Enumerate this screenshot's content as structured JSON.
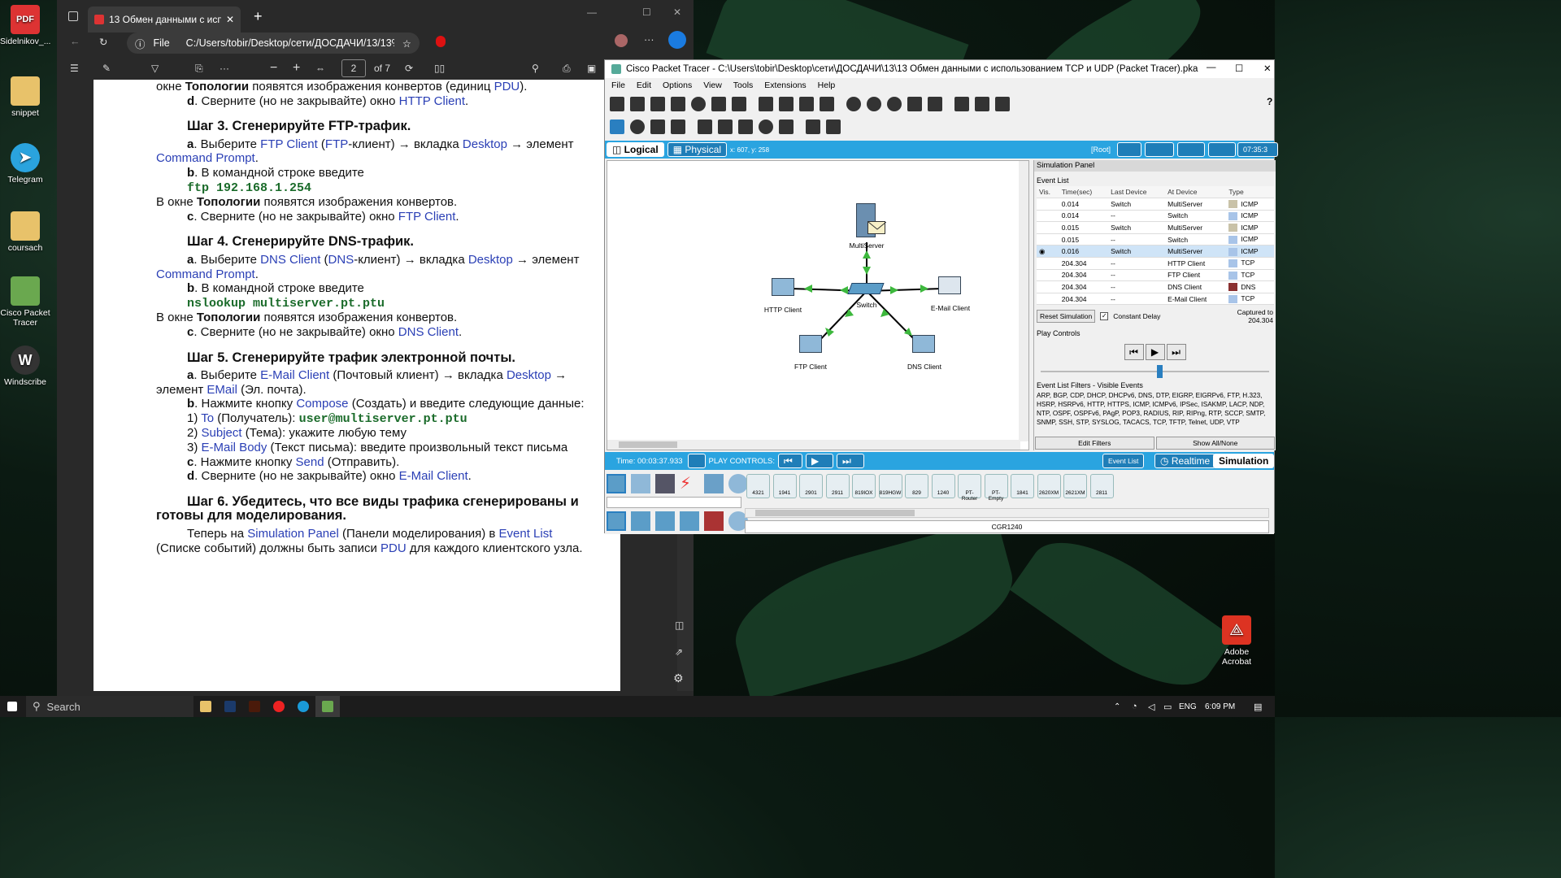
{
  "desktop": {
    "icons": [
      {
        "label": "Sidelnikov_...",
        "icon": "pdf-file-icon"
      },
      {
        "label": "snippet",
        "icon": "folder-icon"
      },
      {
        "label": "Telegram",
        "icon": "telegram-icon"
      },
      {
        "label": "coursach",
        "icon": "folder-icon"
      },
      {
        "label": "Cisco Packet Tracer",
        "icon": "cisco-icon"
      },
      {
        "label": "Windscribe",
        "icon": "windscribe-icon"
      }
    ],
    "acrobat": "Adobe Acrobat"
  },
  "pdf": {
    "tab_title": "13 Обмен данными с использо",
    "file_label": "File",
    "address": "C:/Users/tobir/Desktop/сети/ДОСДАЧИ/13/13%...",
    "page_current": "2",
    "page_total": "of 7",
    "content": {
      "intro_1a": "окне ",
      "intro_1b": "Топологии",
      "intro_1c": " появятся изображения конвертов (единиц ",
      "intro_1d": "PDU",
      "intro_1e": ").",
      "intro_2a": "d",
      "intro_2b": ". Сверните (но не закрывайте) окно ",
      "intro_2c": "HTTP Client",
      "intro_2d": ".",
      "step3": "Шаг 3. Сгенерируйте FTP-трафик.",
      "s3a1": "a",
      "s3a2": ". Выберите ",
      "s3a3": "FTP Client",
      "s3a4": " (",
      "s3a5": "FTP",
      "s3a6": "-клиент) → вкладка ",
      "s3a7": "Desktop",
      "s3a8": " → элемент",
      "s3b": "Command Prompt",
      "s3b2": ".",
      "s3c1": "b",
      "s3c2": ". В командной строке введите",
      "s3cmd": "ftp 192.168.1.254",
      "s3d1": "В окне ",
      "s3d2": "Топологии",
      "s3d3": " появятся изображения конвертов.",
      "s3e1": "c",
      "s3e2": ". Сверните (но не закрывайте) окно ",
      "s3e3": "FTP Client",
      "s3e4": ".",
      "step4": "Шаг 4. Сгенерируйте DNS-трафик.",
      "s4a3": "DNS Client",
      "s4a5": "DNS",
      "s4cmd": "nslookup multiserver.pt.ptu",
      "s4e3": "DNS Client",
      "step5": "Шаг 5. Сгенерируйте трафик электронной почты.",
      "s5a3": "E-Mail Client",
      "s5a4": " (Почтовый клиент) → вкладка ",
      "s5a5": "Desktop",
      "s5a6": " →",
      "s5b1": "элемент ",
      "s5b2": "EMail",
      "s5b3": " (Эл. почта).",
      "s5c1": "b",
      "s5c2": ". Нажмите кнопку ",
      "s5c3": "Compose",
      "s5c4": " (Создать) и введите следующие данные:",
      "s5d1": "1) ",
      "s5d2": "To",
      "s5d3": " (Получатель): ",
      "s5d4": "user@multiserver.pt.ptu",
      "s5e1": "2) ",
      "s5e2": "Subject",
      "s5e3": " (Тема): укажите любую тему",
      "s5f1": "3) ",
      "s5f2": "E-Mail Body",
      "s5f3": " (Текст письма): введите произвольный текст письма",
      "s5g1": "c",
      "s5g2": ". Нажмите кнопку ",
      "s5g3": "Send",
      "s5g4": " (Отправить).",
      "s5h3": "E-Mail Client",
      "step6": "Шаг 6. Убедитесь, что все виды трафика сгенерированы и готовы для моделирования.",
      "s6a1": "Теперь на ",
      "s6a2": "Simulation Panel",
      "s6a3": " (Панели моделирования) в ",
      "s6a4": "Event List",
      "s6b1": "(Списке событий) должны быть записи ",
      "s6b2": "PDU",
      "s6b3": " для каждого клиентского узла."
    }
  },
  "pt": {
    "title": "Cisco Packet Tracer - C:\\Users\\tobir\\Desktop\\сети\\ДОСДАЧИ\\13\\13 Обмен данными с использованием TCP и UDP (Packet Tracer).pka",
    "menu": [
      "File",
      "Edit",
      "Options",
      "View",
      "Tools",
      "Extensions",
      "Help"
    ],
    "logical": "Logical",
    "physical": "Physical",
    "coords": "x: 607, y: 258",
    "root": "[Root]",
    "clock": "07:35:3",
    "nodes": {
      "server": "MultiServer",
      "switch": "Switch",
      "http": "HTTP Client",
      "email": "E-Mail Client",
      "ftp": "FTP Client",
      "dns": "DNS Client"
    },
    "sim": {
      "panel_title": "Simulation Panel",
      "event_list": "Event List",
      "headers": [
        "Vis.",
        "Time(sec)",
        "Last Device",
        "At Device",
        "Type"
      ],
      "rows": [
        {
          "time": "0.014",
          "last": "Switch",
          "at": "MultiServer",
          "type": "ICMP",
          "color": "#c9c2a8"
        },
        {
          "time": "0.014",
          "last": "--",
          "at": "Switch",
          "type": "ICMP",
          "color": "#a8c4e8"
        },
        {
          "time": "0.015",
          "last": "Switch",
          "at": "MultiServer",
          "type": "ICMP",
          "color": "#c9c2a8"
        },
        {
          "time": "0.015",
          "last": "--",
          "at": "Switch",
          "type": "ICMP",
          "color": "#a8c4e8"
        },
        {
          "time": "0.016",
          "last": "Switch",
          "at": "MultiServer",
          "type": "ICMP",
          "color": "#a8c4e8"
        },
        {
          "time": "204.304",
          "last": "--",
          "at": "HTTP Client",
          "type": "TCP",
          "color": "#a8c4e8"
        },
        {
          "time": "204.304",
          "last": "--",
          "at": "FTP Client",
          "type": "TCP",
          "color": "#a8c4e8"
        },
        {
          "time": "204.304",
          "last": "--",
          "at": "DNS Client",
          "type": "DNS",
          "color": "#8a3030"
        },
        {
          "time": "204.304",
          "last": "--",
          "at": "E-Mail Client",
          "type": "TCP",
          "color": "#a8c4e8"
        }
      ],
      "reset": "Reset Simulation",
      "constant_delay": "Constant Delay",
      "captured": "Captured to",
      "captured_val": "204.304",
      "play_controls": "Play Controls",
      "filters_title": "Event List Filters - Visible Events",
      "filters": "ARP, BGP, CDP, DHCP, DHCPv6, DNS, DTP, EIGRP, EIGRPv6, FTP, H.323, HSRP, HSRPv6, HTTP, HTTPS, ICMP, ICMPv6, IPSec, ISAKMP, LACP, NDP, NTP, OSPF, OSPFv6, PAgP, POP3, RADIUS, RIP, RIPng, RTP, SCCP, SMTP, SNMP, SSH, STP, SYSLOG, TACACS, TCP, TFTP, Telnet, UDP, VTP",
      "edit_filters": "Edit Filters",
      "show_all": "Show All/None"
    },
    "bottom": {
      "time": "Time: 00:03:37.933",
      "play": "PLAY CONTROLS:",
      "event_list": "Event List",
      "realtime": "Realtime",
      "simulation": "Simulation"
    },
    "devices": [
      "4321",
      "1941",
      "2901",
      "2911",
      "819IOX",
      "819HGW",
      "829",
      "1240",
      "PT-Router",
      "PT-Empty",
      "1841",
      "2620XM",
      "2621XM",
      "2811"
    ],
    "selected_device": "CGR1240"
  },
  "taskbar": {
    "search": "Search",
    "lang": "ENG",
    "time": "6:09 PM"
  }
}
